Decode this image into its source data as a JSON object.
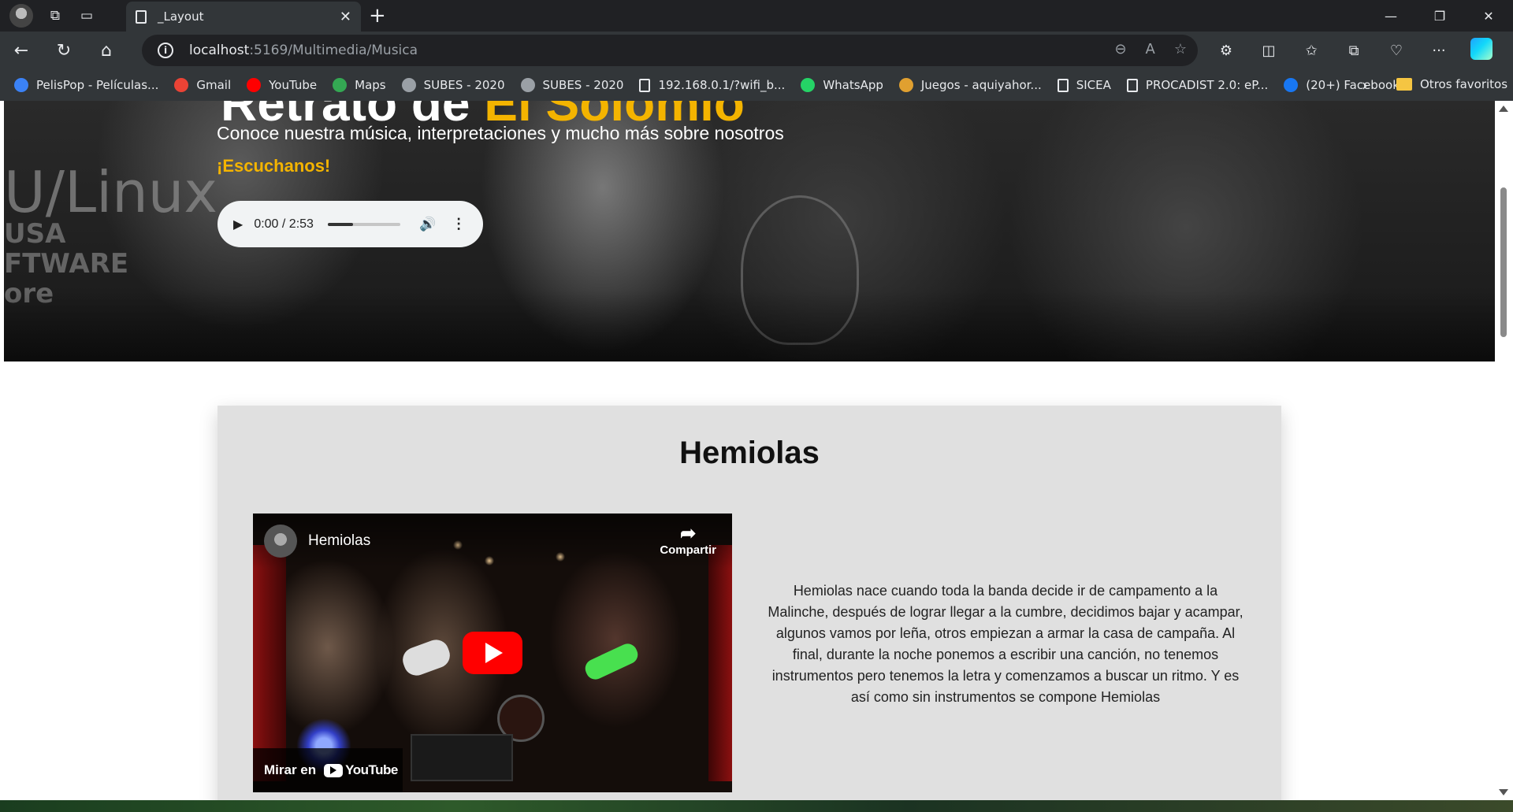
{
  "browser": {
    "tab_title": "_Layout",
    "url_host": "localhost",
    "url_path": ":5169/Multimedia/Musica",
    "bookmarks": [
      {
        "label": "PelisPop - Películas...",
        "color": "#3b82f6"
      },
      {
        "label": "Gmail",
        "color": "#ea4335"
      },
      {
        "label": "YouTube",
        "color": "#ff0000"
      },
      {
        "label": "Maps",
        "color": "#34a853"
      },
      {
        "label": "SUBES - 2020",
        "color": "#9aa0a6"
      },
      {
        "label": "SUBES - 2020",
        "color": "#9aa0a6"
      },
      {
        "label": "192.168.0.1/?wifi_b...",
        "color": "doc"
      },
      {
        "label": "WhatsApp",
        "color": "#25d366"
      },
      {
        "label": "Juegos - aquiyahor...",
        "color": "#e0a030"
      },
      {
        "label": "SICEA",
        "color": "doc"
      },
      {
        "label": "PROCADIST 2.0: eP...",
        "color": "doc"
      },
      {
        "label": "(20+) Facebook",
        "color": "#1877f2"
      }
    ],
    "other_favorites": "Otros favoritos"
  },
  "hero": {
    "title_white": "Retrato de ",
    "title_accent": "El Solomio",
    "subtitle": "Conoce nuestra música, interpretaciones y mucho más sobre nosotros",
    "cta": "¡Escuchanos!",
    "audio_time": "0:00 / 2:53",
    "audio_progress": 0.35,
    "wall_text": "U/Linux",
    "wall_text2": "USA\nFTWARE\nore",
    "accent_color": "#f4b400"
  },
  "song": {
    "title": "Hemiolas",
    "video_title": "Hemiolas",
    "share_label": "Compartir",
    "watch_on": "Mirar en",
    "youtube_logo": "YouTube",
    "description": "Hemiolas nace cuando toda la banda decide ir de campamento a la Malinche, después de lograr llegar a la cumbre, decidimos bajar y acampar, algunos vamos por leña, otros empiezan a armar la casa de campaña. Al final, durante la noche ponemos a escribir una canción, no tenemos instrumentos pero tenemos la letra y comenzamos a buscar un ritmo. Y es así como sin instrumentos se compone Hemiolas"
  }
}
